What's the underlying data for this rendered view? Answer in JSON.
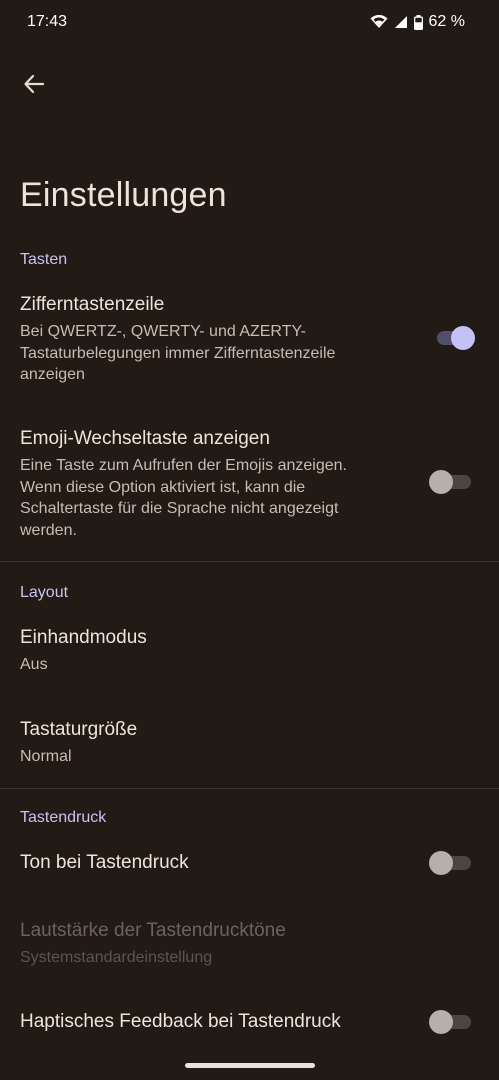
{
  "status": {
    "time": "17:43",
    "battery": "62 %"
  },
  "page": {
    "title": "Einstellungen"
  },
  "sections": {
    "keys": {
      "header": "Tasten"
    },
    "layout": {
      "header": "Layout"
    },
    "keypress": {
      "header": "Tastendruck"
    }
  },
  "items": {
    "number_row": {
      "title": "Zifferntastenzeile",
      "subtitle": "Bei QWERTZ-, QWERTY- und AZERTY-Tastaturbelegungen immer Zifferntastenzeile anzeigen",
      "enabled": true
    },
    "emoji_switch": {
      "title": "Emoji-Wechseltaste anzeigen",
      "subtitle": "Eine Taste zum Aufrufen der Emojis anzeigen. Wenn diese Option aktiviert ist, kann die Schaltertaste für die Sprache nicht angezeigt werden.",
      "enabled": false
    },
    "one_hand": {
      "title": "Einhandmodus",
      "subtitle": "Aus"
    },
    "keyboard_size": {
      "title": "Tastaturgröße",
      "subtitle": "Normal"
    },
    "key_sound": {
      "title": "Ton bei Tastendruck",
      "enabled": false
    },
    "key_volume": {
      "title": "Lautstärke der Tastendrucktöne",
      "subtitle": "Systemstandardeinstellung"
    },
    "haptic": {
      "title": "Haptisches Feedback bei Tastendruck",
      "enabled": false
    }
  },
  "colors": {
    "background": "#211a15",
    "accent": "#c5c0f6",
    "section_header": "#c8c3f2"
  },
  "icons": {
    "back": "arrow-back-icon",
    "wifi": "wifi-icon",
    "signal": "signal-icon",
    "battery": "battery-icon"
  }
}
